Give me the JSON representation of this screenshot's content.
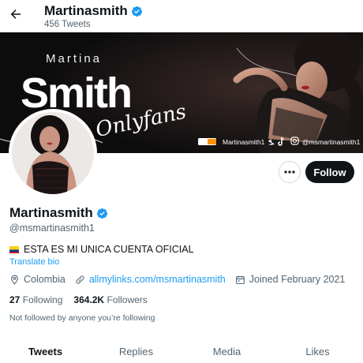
{
  "header": {
    "name": "Martinasmith",
    "tweet_count": "456 Tweets",
    "verified": true,
    "back_icon": "arrow-left-icon"
  },
  "banner": {
    "first_name": "Martina",
    "last_name": "Smith",
    "script_text": "Onlyfans",
    "socials": [
      {
        "icon": "pornhub-logo",
        "label": "Martinasmith1"
      },
      {
        "icon": "twitter-icon",
        "label": ""
      },
      {
        "icon": "tiktok-icon",
        "label": ""
      },
      {
        "icon": "instagram-icon",
        "label": "@msmartinasmith1"
      }
    ]
  },
  "actions": {
    "more_icon": "more-horizontal-icon",
    "follow_label": "Follow"
  },
  "profile": {
    "name": "Martinasmith",
    "handle": "@msmartinasmith1",
    "bio": "ESTA ES MI UNICA CUENTA OFICIAL",
    "bio_flag": "colombia-flag",
    "translate_label": "Translate bio",
    "location": "Colombia",
    "website": "allmylinks.com/msmartinasmith",
    "joined": "Joined February 2021",
    "following_count": "27",
    "following_label": "Following",
    "followers_count": "364.2K",
    "followers_label": "Followers",
    "not_followed": "Not followed by anyone you’re following"
  },
  "tabs": [
    {
      "label": "Tweets",
      "active": true
    },
    {
      "label": "Replies",
      "active": false
    },
    {
      "label": "Media",
      "active": false
    },
    {
      "label": "Likes",
      "active": false
    }
  ],
  "colors": {
    "accent": "#1d9bf0",
    "text": "#0f1419",
    "secondary": "#536471",
    "follow_bg": "#0f1419"
  }
}
